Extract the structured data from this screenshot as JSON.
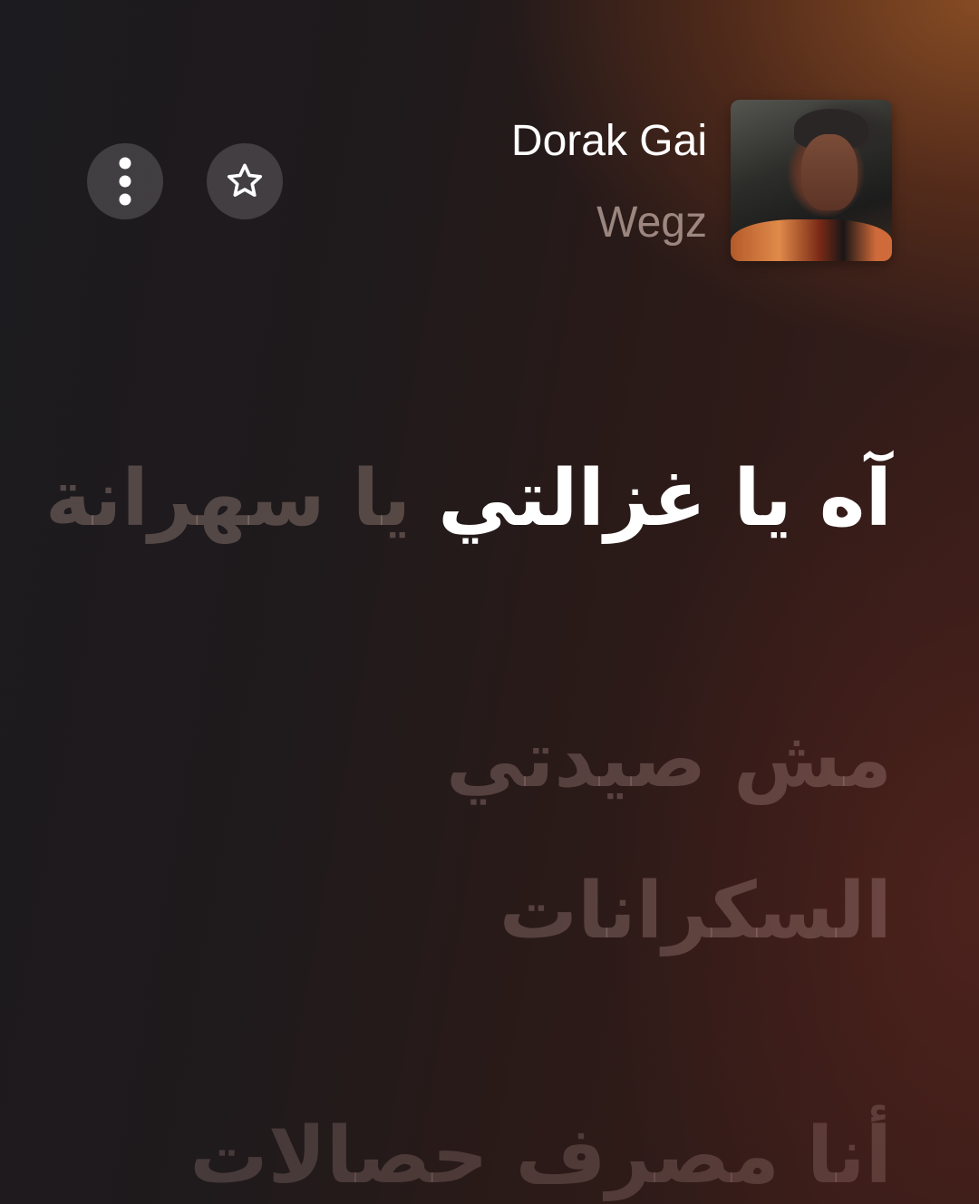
{
  "colors": {
    "accent_warm": "#8a4e24",
    "text_primary": "#ffffff",
    "text_secondary": "#c8b4ac"
  },
  "header": {
    "title": "Dorak Gai",
    "artist": "Wegz",
    "buttons": {
      "more_icon": "more-vertical-icon",
      "favorite_icon": "star-outline-icon"
    }
  },
  "lyrics": {
    "current": {
      "sung": "آه يا غزالتي",
      "unsung": "يا سهرانة"
    },
    "upcoming": [
      "مش صيدتي",
      "السكرانات",
      "أنا مصرف حصالات"
    ]
  }
}
